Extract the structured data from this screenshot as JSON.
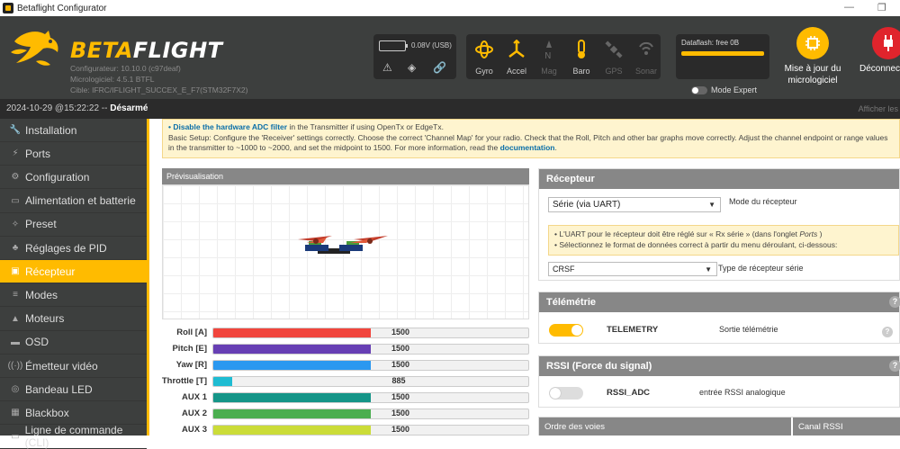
{
  "window": {
    "title": "Betaflight Configurator",
    "minimize": "—",
    "restore": "❐"
  },
  "brand": {
    "beta": "BETA",
    "flight": "FLIGHT"
  },
  "build": {
    "configurator": "Configurateur: 10.10.0 (c97deaf)",
    "firmware": "Micrologiciel: 4.5.1 BTFL",
    "target": "Cible: IFRC/IFLIGHT_SUCCEX_E_F7(STM32F7X2)"
  },
  "battery": {
    "text": "0.08V (USB)"
  },
  "sensors": [
    {
      "label": "Gyro",
      "active": true
    },
    {
      "label": "Accel",
      "active": true
    },
    {
      "label": "Mag",
      "active": false
    },
    {
      "label": "Baro",
      "active": true
    },
    {
      "label": "GPS",
      "active": false
    },
    {
      "label": "Sonar",
      "active": false
    }
  ],
  "dataflash": {
    "text": "Dataflash: free 0B"
  },
  "expert_mode": {
    "label": "Mode Expert",
    "enabled": false
  },
  "buttons": {
    "update_line1": "Mise à jour du",
    "update_line2": "micrologiciel",
    "disconnect": "Déconnect"
  },
  "status": {
    "datetime": "2024-10-29 @15:22:22 -- ",
    "state": "Désarmé",
    "log": "Afficher les"
  },
  "nav": [
    {
      "label": "Installation",
      "icon": "wrench-icon",
      "glyph": "🔧"
    },
    {
      "label": "Ports",
      "icon": "plug-icon",
      "glyph": "⚡"
    },
    {
      "label": "Configuration",
      "icon": "gear-icon",
      "glyph": "⚙"
    },
    {
      "label": "Alimentation et batterie",
      "icon": "battery-icon",
      "glyph": "▭"
    },
    {
      "label": "Preset",
      "icon": "magic-wand-icon",
      "glyph": "✧"
    },
    {
      "label": "Réglages de PID",
      "icon": "pid-tree-icon",
      "glyph": "♣"
    },
    {
      "label": "Récepteur",
      "icon": "receiver-icon",
      "glyph": "▣",
      "active": true
    },
    {
      "label": "Modes",
      "icon": "modes-icon",
      "glyph": "≡"
    },
    {
      "label": "Moteurs",
      "icon": "motor-icon",
      "glyph": "▲"
    },
    {
      "label": "OSD",
      "icon": "osd-icon",
      "glyph": "▬"
    },
    {
      "label": "Émetteur vidéo",
      "icon": "vtx-icon",
      "glyph": "((·))"
    },
    {
      "label": "Bandeau LED",
      "icon": "led-icon",
      "glyph": "◎"
    },
    {
      "label": "Blackbox",
      "icon": "blackbox-icon",
      "glyph": "▦"
    },
    {
      "label": "Ligne de commande (CLI)",
      "icon": "cli-icon",
      "glyph": "▭"
    }
  ],
  "note": {
    "bullet_strong": "Disable the hardware ADC filter",
    "bullet_rest": " in the Transmitter if using OpenTx or EdgeTx.",
    "text": "Basic Setup: Configure the 'Receiver' settings correctly. Choose the correct 'Channel Map' for your radio. Check that the Roll, Pitch and other bar graphs move correctly. Adjust the channel endpoint or range values in the transmitter to ~1000 to ~2000, and set the midpoint to 1500. For more information, read the ",
    "link": "documentation",
    "end": "."
  },
  "preview": {
    "title": "Prévisualisation"
  },
  "channels": [
    {
      "label": "Roll [A]",
      "value": "1500",
      "fill": 0.5,
      "color": "#f1453d"
    },
    {
      "label": "Pitch [E]",
      "value": "1500",
      "fill": 0.5,
      "color": "#673fb4"
    },
    {
      "label": "Yaw [R]",
      "value": "1500",
      "fill": 0.5,
      "color": "#2b98f0"
    },
    {
      "label": "Throttle [T]",
      "value": "885",
      "fill": 0.06,
      "color": "#1fbcd2"
    },
    {
      "label": "AUX 1",
      "value": "1500",
      "fill": 0.5,
      "color": "#159588"
    },
    {
      "label": "AUX 2",
      "value": "1500",
      "fill": 0.5,
      "color": "#4bae4f"
    },
    {
      "label": "AUX 3",
      "value": "1500",
      "fill": 0.5,
      "color": "#cbdc38"
    }
  ],
  "receiver": {
    "title": "Récepteur",
    "mode_value": "Série (via UART)",
    "mode_label": "Mode du récepteur",
    "info1": "• L'UART pour le récepteur doit être réglé sur « Rx série » (dans l'onglet ",
    "info1_em": "Ports",
    "info1_end": " )",
    "info2": "• Sélectionnez le format de données correct à partir du menu déroulant, ci-dessous:",
    "serial_value": "CRSF",
    "serial_label": "Type de récepteur série"
  },
  "telemetry": {
    "title": "Télémétrie",
    "name": "TELEMETRY",
    "desc": "Sortie télémétrie",
    "enabled": true
  },
  "rssi": {
    "title": "RSSI (Force du signal)",
    "name": "RSSI_ADC",
    "desc": "entrée RSSI analogique",
    "enabled": false
  },
  "table": {
    "col1": "Ordre des voies",
    "col2": "Canal RSSI"
  },
  "colors": {
    "accent": "#ffbb00",
    "header_bg": "#3d3f3e",
    "panel_head": "#878787"
  }
}
